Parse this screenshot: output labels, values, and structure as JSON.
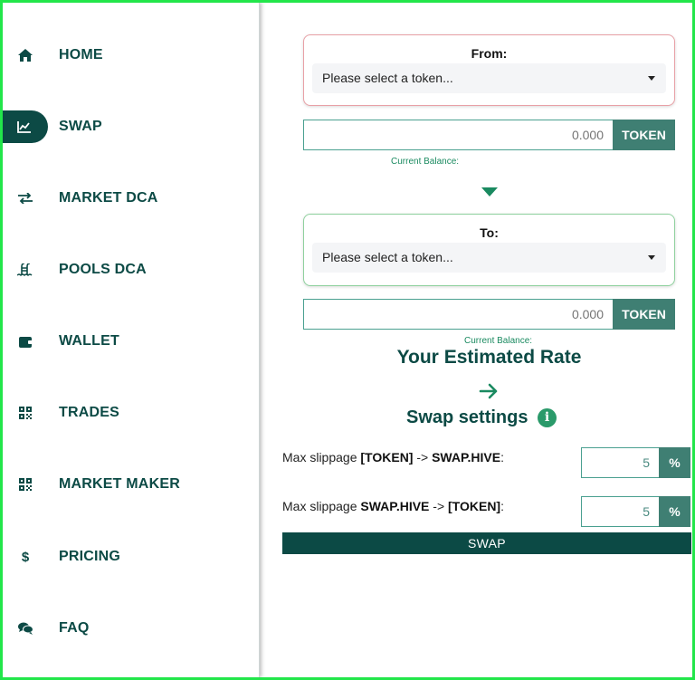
{
  "sidebar": {
    "items": [
      {
        "label": "HOME",
        "icon": "home-icon"
      },
      {
        "label": "SWAP",
        "icon": "chart-line-icon",
        "active": true
      },
      {
        "label": "MARKET DCA",
        "icon": "exchange-arrows-icon"
      },
      {
        "label": "POOLS DCA",
        "icon": "pool-ladder-icon"
      },
      {
        "label": "WALLET",
        "icon": "wallet-icon"
      },
      {
        "label": "TRADES",
        "icon": "qrcode-icon"
      },
      {
        "label": "MARKET MAKER",
        "icon": "qrcode-icon"
      },
      {
        "label": "PRICING",
        "icon": "dollar-icon"
      },
      {
        "label": "FAQ",
        "icon": "comments-icon"
      }
    ]
  },
  "swap": {
    "from": {
      "title": "From:",
      "select_placeholder": "Please select a token...",
      "amount_placeholder": "0.000",
      "token_label": "TOKEN",
      "balance_label": "Current Balance:"
    },
    "to": {
      "title": "To:",
      "select_placeholder": "Please select a token...",
      "amount_placeholder": "0.000",
      "token_label": "TOKEN",
      "balance_label": "Current Balance:"
    },
    "rate_title": "Your Estimated Rate",
    "settings_title": "Swap settings",
    "slippage": [
      {
        "prefix": "Max slippage ",
        "from": "[TOKEN]",
        "arrow": " -> ",
        "to": "SWAP.HIVE",
        "suffix": ":",
        "value": "5",
        "unit": "%"
      },
      {
        "prefix": "Max slippage ",
        "from": "SWAP.HIVE",
        "arrow": " -> ",
        "to": "[TOKEN]",
        "suffix": ":",
        "value": "5",
        "unit": "%"
      }
    ],
    "submit_label": "SWAP"
  },
  "colors": {
    "brand_dark": "#0c4a45",
    "brand_mid": "#3f7f73",
    "accent_green": "#1a8a60",
    "frame": "#22e64a"
  }
}
